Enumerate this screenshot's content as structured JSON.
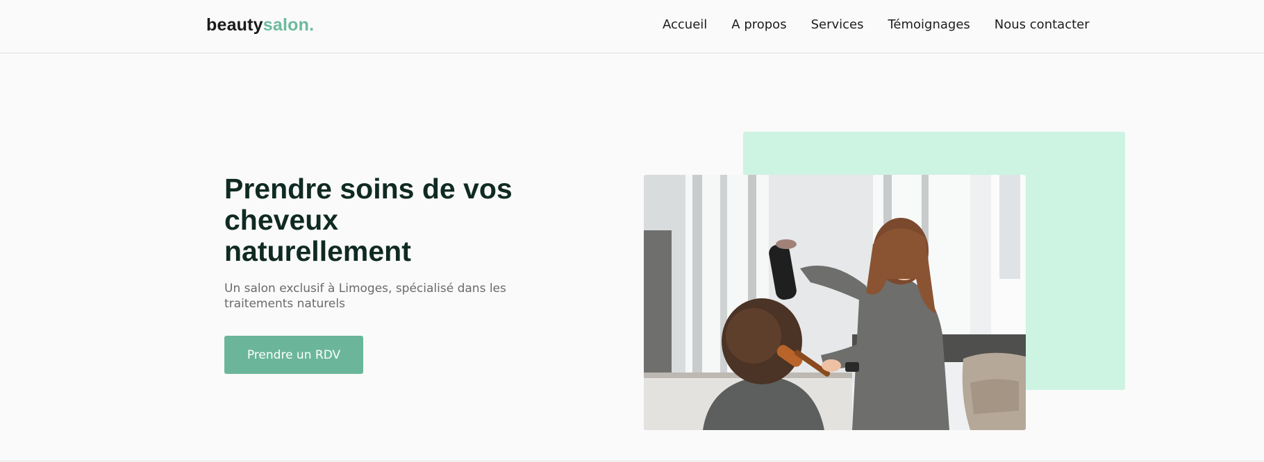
{
  "header": {
    "logo": {
      "part1": "beauty",
      "part2": "salon."
    },
    "nav": [
      "Accueil",
      "A propos",
      "Services",
      "Témoignages",
      "Nous contacter"
    ]
  },
  "hero": {
    "title_lines": [
      "Prendre soins de vos",
      "cheveux",
      "naturellement"
    ],
    "subtitle_lines": [
      "Un salon exclusif à Limoges, spécialisé dans les",
      "traitements naturels"
    ],
    "cta_label": "Prendre un RDV"
  },
  "colors": {
    "accent": "#6bb69a",
    "mint": "#cdf3e3",
    "heading": "#0f2a22"
  },
  "image": {
    "subject": "hairdresser-blow-drying-client-photo"
  }
}
